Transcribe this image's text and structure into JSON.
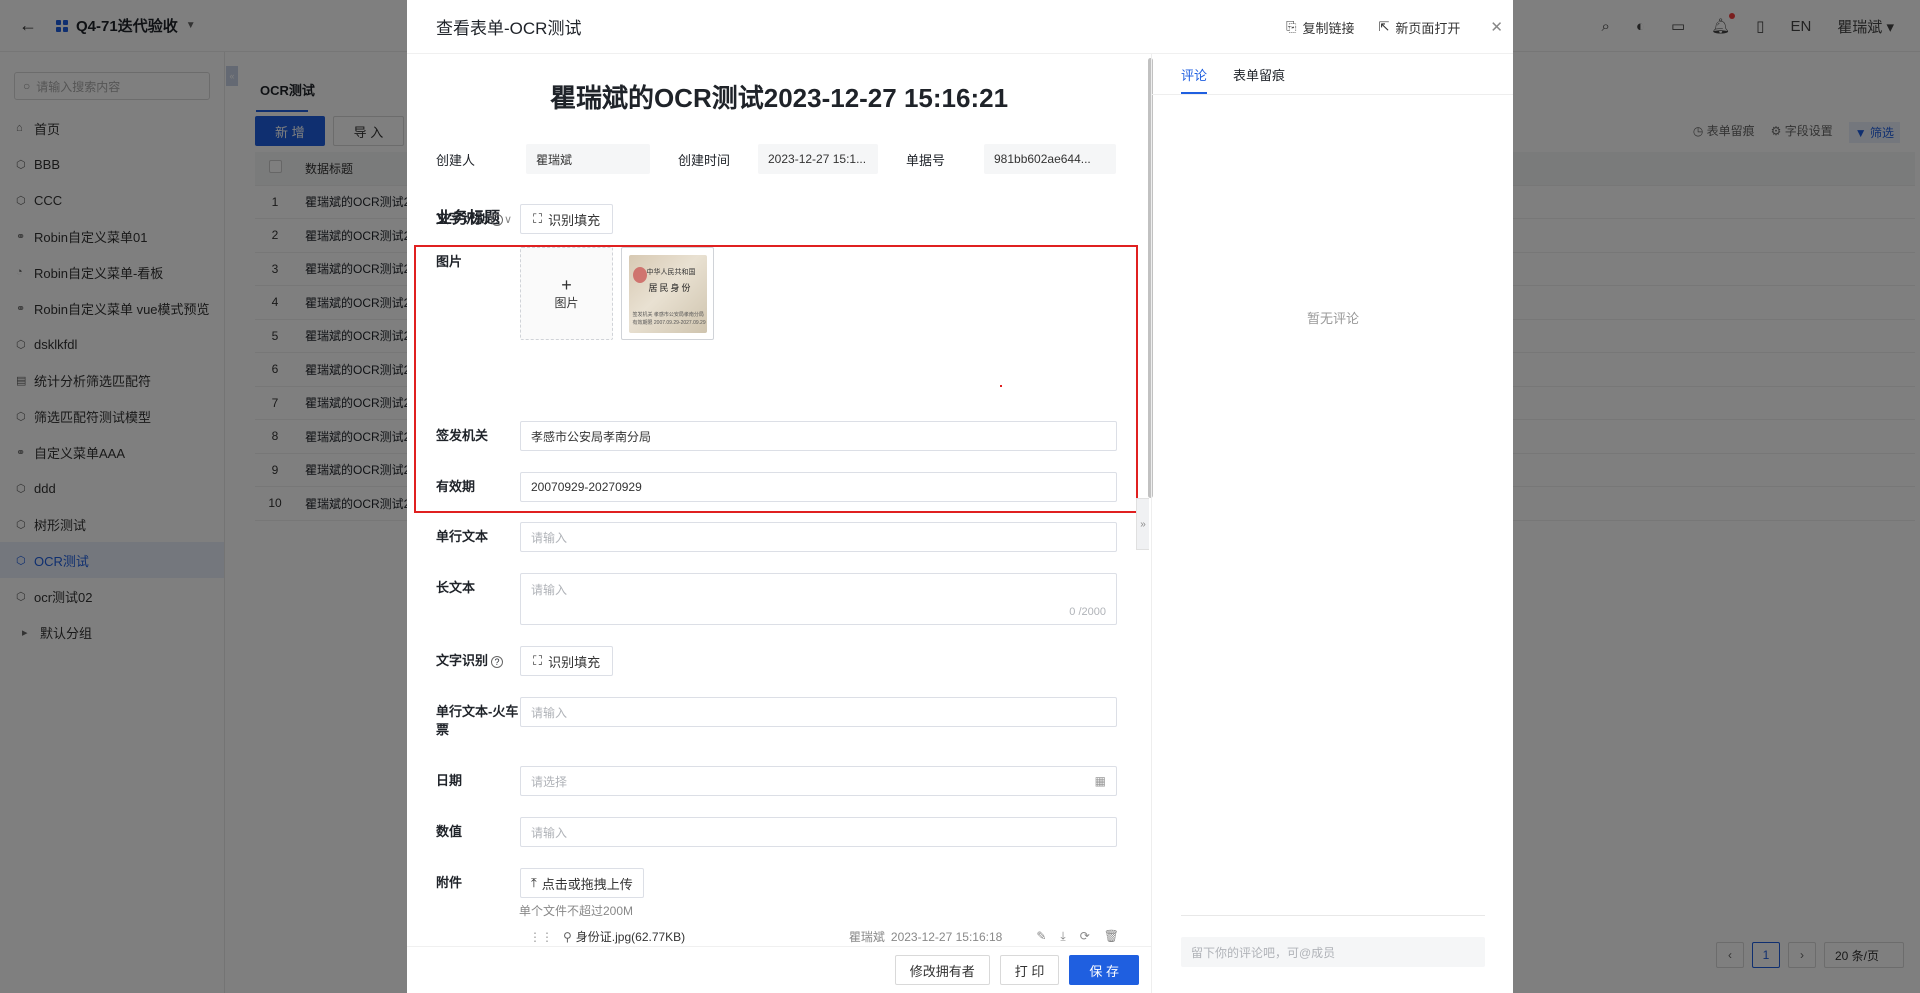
{
  "app": {
    "title": "Q4-71迭代验收",
    "lang": "EN",
    "user": "瞿瑞斌"
  },
  "sidebar": {
    "search_placeholder": "请输入搜索内容",
    "items": [
      {
        "label": "首页",
        "icon": "home-icon"
      },
      {
        "label": "BBB",
        "icon": "cube-icon"
      },
      {
        "label": "CCC",
        "icon": "cube-icon"
      },
      {
        "label": "Robin自定义菜单01",
        "icon": "link-icon"
      },
      {
        "label": "Robin自定义菜单-看板",
        "icon": "dashboard-icon"
      },
      {
        "label": "Robin自定义菜单 vue模式预览",
        "icon": "link-icon"
      },
      {
        "label": "dsklkfdl",
        "icon": "cube-icon"
      },
      {
        "label": "统计分析筛选匹配符",
        "icon": "chart-icon"
      },
      {
        "label": "筛选匹配符测试模型",
        "icon": "cube-icon"
      },
      {
        "label": "自定义菜单AAA",
        "icon": "link-icon"
      },
      {
        "label": "ddd",
        "icon": "cube-icon"
      },
      {
        "label": "树形测试",
        "icon": "cube-icon"
      },
      {
        "label": "OCR测试",
        "icon": "cube-icon"
      },
      {
        "label": "ocr测试02",
        "icon": "cube-icon"
      }
    ],
    "group": "默认分组"
  },
  "main": {
    "tab": "OCR测试",
    "new_button": "新 增",
    "import_button": "导 入",
    "column_title": "数据标题",
    "rows": [
      {
        "n": "1",
        "title": "瞿瑞斌的OCR测试2023"
      },
      {
        "n": "2",
        "title": "瞿瑞斌的OCR测试2023"
      },
      {
        "n": "3",
        "title": "瞿瑞斌的OCR测试2023"
      },
      {
        "n": "4",
        "title": "瞿瑞斌的OCR测试2023"
      },
      {
        "n": "5",
        "title": "瞿瑞斌的OCR测试2023"
      },
      {
        "n": "6",
        "title": "瞿瑞斌的OCR测试2023"
      },
      {
        "n": "7",
        "title": "瞿瑞斌的OCR测试2023"
      },
      {
        "n": "8",
        "title": "瞿瑞斌的OCR测试2023"
      },
      {
        "n": "9",
        "title": "瞿瑞斌的OCR测试2023"
      },
      {
        "n": "10",
        "title": "瞿瑞斌的OCR测试2023"
      }
    ],
    "tools": [
      "表单留痕",
      "字段设置",
      "筛选"
    ],
    "page": "1",
    "page_size": "20 条/页"
  },
  "modal": {
    "title": "查看表单-OCR测试",
    "copy_link": "复制链接",
    "open_new_page": "新页面打开",
    "record_title": "瞿瑞斌的OCR测试2023-12-27 15:16:21",
    "meta": {
      "creator_label": "创建人",
      "creator": "瞿瑞斌",
      "created_label": "创建时间",
      "created": "2023-12-27 15:1...",
      "doc_label": "单据号",
      "doc": "981bb602ae644..."
    },
    "section": "业务标题",
    "fields": {
      "ocr_label": "文字识别",
      "ocr_button": "识别填充",
      "image_label": "图片",
      "image_add": "图片",
      "idcard_line1": "中华人民共和国",
      "idcard_line2": "居民身份",
      "idcard_line3": "签发机关 孝感市公安局孝南分局",
      "idcard_line4": "有效期限 2007.09.29-2027.09.29",
      "issuer_label": "签发机关",
      "issuer_value": "孝感市公安局孝南分局",
      "validity_label": "有效期",
      "validity_value": "20070929-20270929",
      "single_text_label": "单行文本",
      "single_text_placeholder": "请输入",
      "long_text_label": "长文本",
      "long_text_placeholder": "请输入",
      "long_text_counter": "0 /2000",
      "ocr2_label": "文字识别",
      "ocr2_button": "识别填充",
      "train_label": "单行文本-火车票",
      "train_placeholder": "请输入",
      "date_label": "日期",
      "date_placeholder": "请选择",
      "number_label": "数值",
      "number_placeholder": "请输入",
      "attachment_label": "附件",
      "upload_button": "点击或拖拽上传",
      "upload_hint": "单个文件不超过200M",
      "file_name": "身份证.jpg(62.77KB)",
      "file_user": "瞿瑞斌",
      "file_time": "2023-12-27 15:16:18"
    },
    "footer": {
      "change_owner": "修改拥有者",
      "print": "打 印",
      "save": "保 存"
    },
    "comments": {
      "tab_comments": "评论",
      "tab_trace": "表单留痕",
      "empty": "暂无评论",
      "input_placeholder": "留下你的评论吧，可@成员"
    }
  },
  "colors": {
    "accent": "#1f5fe0",
    "highlight_box": "#e02020"
  }
}
